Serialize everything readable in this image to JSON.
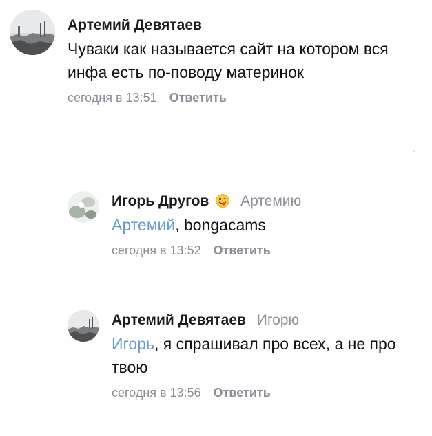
{
  "comments": [
    {
      "author": "Артемий Девятаев",
      "text": "Чуваки как называется сайт на котором вся инфа есть по-поводу материнок",
      "time": "сегодня в 13:51",
      "reply_label": "Ответить",
      "avatar_icon": "landscape-photo-avatar"
    },
    {
      "author": "Игорь Другов",
      "author_emoji": "winking-tongue-emoji",
      "reply_to": "Артемию",
      "mention": "Артемий",
      "text": ", bongacams",
      "time": "сегодня в 13:52",
      "reply_label": "Ответить",
      "avatar_icon": "abstract-photo-avatar"
    },
    {
      "author": "Артемий Девятаев",
      "reply_to": "Игорю",
      "mention": "Игорь",
      "text": ", я спрашивал про всех, а не про твою",
      "time": "сегодня в 13:56",
      "reply_label": "Ответить",
      "avatar_icon": "landscape-photo-avatar"
    }
  ],
  "colors": {
    "mention": "#6b9ad0",
    "meta": "#8a8f96",
    "text": "#111111"
  }
}
